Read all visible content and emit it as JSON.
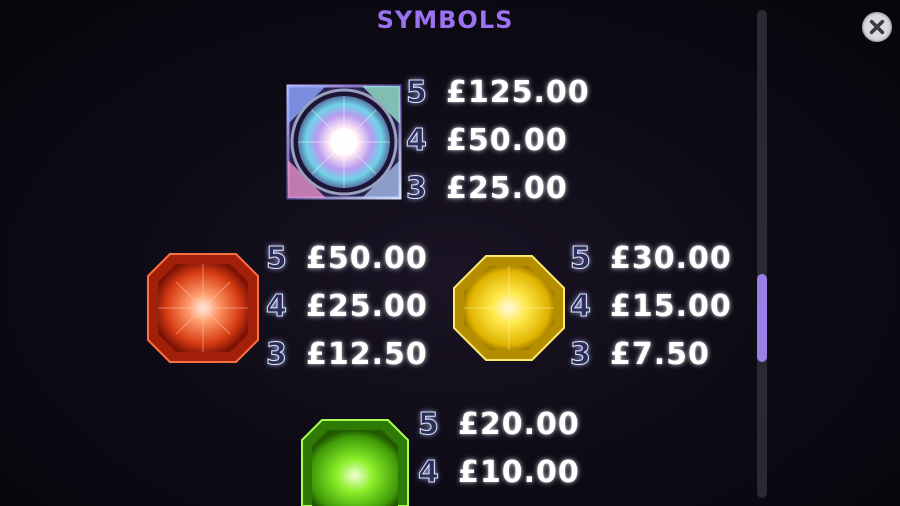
{
  "header": {
    "title": "SYMBOLS"
  },
  "close": {
    "icon": "close-icon"
  },
  "symbols": [
    {
      "name": "rainbow-diamond-icon",
      "payouts": [
        {
          "count": "5",
          "amount": "£125.00"
        },
        {
          "count": "4",
          "amount": "£50.00"
        },
        {
          "count": "3",
          "amount": "£25.00"
        }
      ]
    },
    {
      "name": "red-gem-icon",
      "payouts": [
        {
          "count": "5",
          "amount": "£50.00"
        },
        {
          "count": "4",
          "amount": "£25.00"
        },
        {
          "count": "3",
          "amount": "£12.50"
        }
      ]
    },
    {
      "name": "yellow-gem-icon",
      "payouts": [
        {
          "count": "5",
          "amount": "£30.00"
        },
        {
          "count": "4",
          "amount": "£15.00"
        },
        {
          "count": "3",
          "amount": "£7.50"
        }
      ]
    },
    {
      "name": "green-gem-icon",
      "payouts": [
        {
          "count": "5",
          "amount": "£20.00"
        },
        {
          "count": "4",
          "amount": "£10.00"
        }
      ]
    }
  ],
  "colors": {
    "title": "#9b72f0",
    "scrollbar_thumb": "#9a7fe6",
    "background": "#0d0a14"
  }
}
